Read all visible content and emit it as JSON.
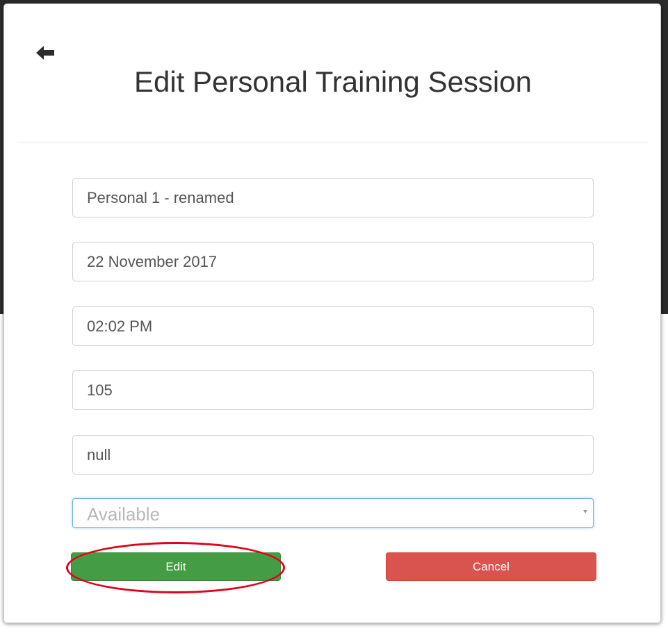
{
  "modal": {
    "title": "Edit Personal Training Session",
    "back_icon": "arrow-left-icon"
  },
  "form": {
    "name": "Personal 1 - renamed",
    "date": "22 November 2017",
    "time": "02:02 PM",
    "capacity": "105",
    "extra": "null",
    "status": "Available",
    "status_caret_icon": "caret-down-icon"
  },
  "buttons": {
    "edit_label": "Edit",
    "cancel_label": "Cancel"
  },
  "colors": {
    "edit": "#449d44",
    "cancel": "#d9534f",
    "focus_border": "#66afe9",
    "annotation": "#e3001b"
  }
}
